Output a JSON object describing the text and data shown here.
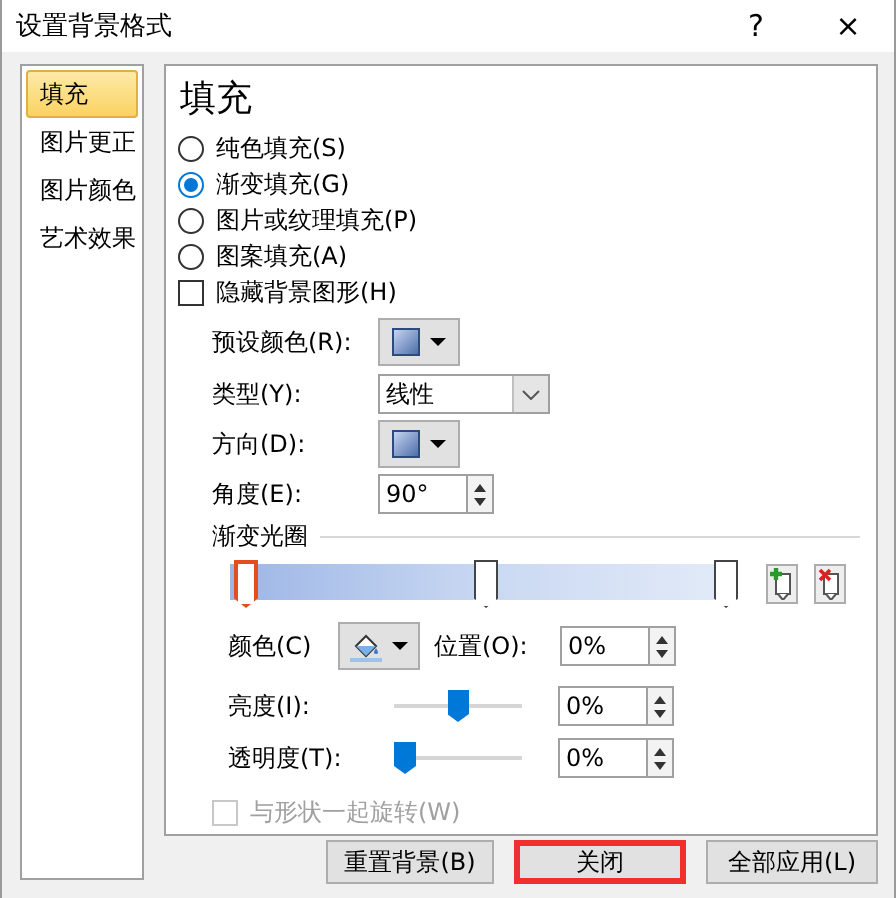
{
  "window": {
    "title": "设置背景格式",
    "help": "?",
    "close": "×"
  },
  "sidebar": {
    "items": [
      {
        "label": "填充",
        "selected": true
      },
      {
        "label": "图片更正",
        "selected": false
      },
      {
        "label": "图片颜色",
        "selected": false
      },
      {
        "label": "艺术效果",
        "selected": false
      }
    ]
  },
  "panel": {
    "heading": "填充",
    "fill_options": [
      {
        "label": "纯色填充(S)",
        "selected": false
      },
      {
        "label": "渐变填充(G)",
        "selected": true
      },
      {
        "label": "图片或纹理填充(P)",
        "selected": false
      },
      {
        "label": "图案填充(A)",
        "selected": false
      }
    ],
    "hide_background": {
      "label": "隐藏背景图形(H)",
      "checked": false
    },
    "preset": {
      "label": "预设颜色(R):"
    },
    "type": {
      "label": "类型(Y):",
      "value": "线性"
    },
    "direction": {
      "label": "方向(D):"
    },
    "angle": {
      "label": "角度(E):",
      "value": "90°"
    },
    "stops_section": "渐变光圈",
    "stops": [
      {
        "level": 0,
        "selected": true
      },
      {
        "level": 0.5,
        "selected": false
      },
      {
        "level": 1,
        "selected": false
      }
    ],
    "color": {
      "label": "颜色(C)"
    },
    "position": {
      "label": "位置(O):",
      "value": "0%"
    },
    "brightness": {
      "label": "亮度(I):",
      "level": 0.5,
      "value": "0%"
    },
    "transparency": {
      "label": "透明度(T):",
      "level": 0,
      "value": "0%"
    },
    "rotate": {
      "label": "与形状一起旋转(W)",
      "checked": false,
      "disabled": true
    }
  },
  "buttons": [
    {
      "label": "重置背景(B)",
      "highlighted": false
    },
    {
      "label": "关闭",
      "highlighted": true
    },
    {
      "label": "全部应用(L)",
      "highlighted": false
    }
  ]
}
